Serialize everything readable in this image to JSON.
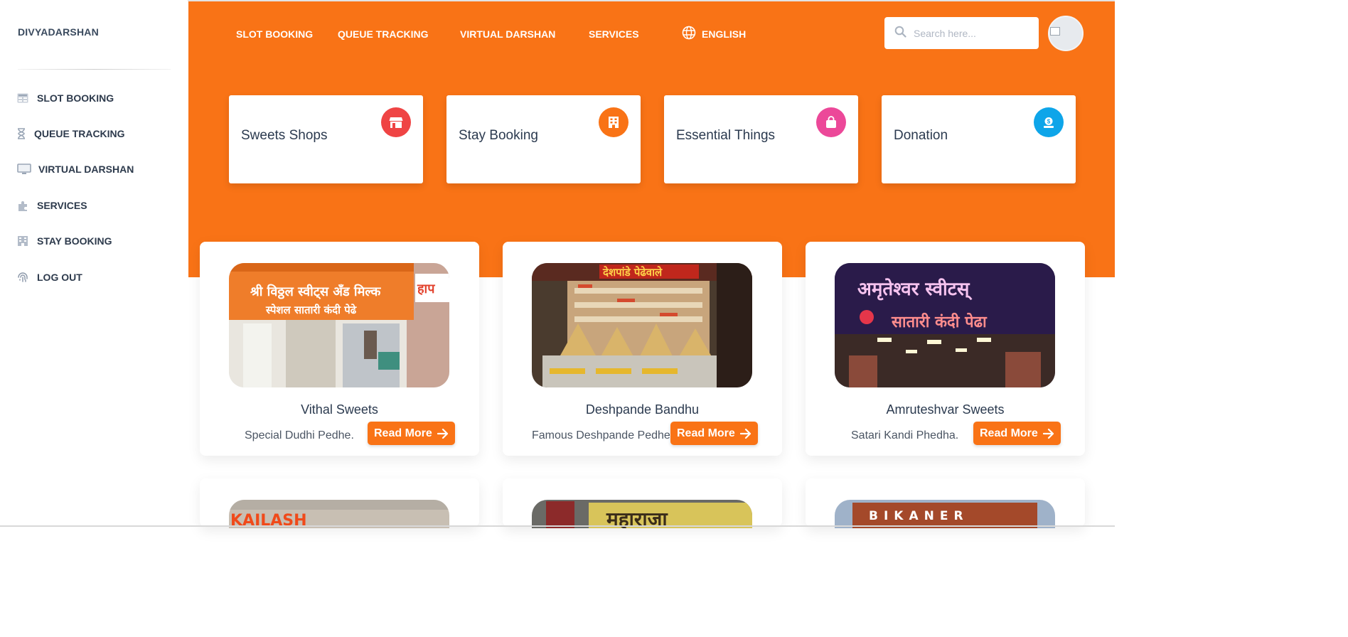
{
  "brand": "DIVYADARSHAN",
  "sidebar": {
    "items": [
      {
        "label": "SLOT BOOKING",
        "icon": "table-icon"
      },
      {
        "label": "QUEUE TRACKING",
        "icon": "hourglass-icon"
      },
      {
        "label": "VIRTUAL DARSHAN",
        "icon": "monitor-icon"
      },
      {
        "label": "SERVICES",
        "icon": "puzzle-icon"
      },
      {
        "label": "STAY BOOKING",
        "icon": "building-icon"
      },
      {
        "label": "LOG OUT",
        "icon": "fingerprint-icon"
      }
    ]
  },
  "topnav": {
    "items": [
      "SLOT BOOKING",
      "QUEUE TRACKING",
      "VIRTUAL DARSHAN",
      "SERVICES"
    ],
    "language": "ENGLISH"
  },
  "search": {
    "placeholder": "Search here..."
  },
  "categories": [
    {
      "title": "Sweets Shops",
      "color": "#ef4444",
      "icon": "store-icon"
    },
    {
      "title": "Stay Booking",
      "color": "#f97316",
      "icon": "hotel-icon"
    },
    {
      "title": "Essential Things",
      "color": "#ec4899",
      "icon": "shopping-bag-icon"
    },
    {
      "title": "Donation",
      "color": "#0ea5e9",
      "icon": "donation-icon"
    }
  ],
  "shops": [
    {
      "name": "Vithal Sweets",
      "desc": "Special Dudhi Pedhe.",
      "button": "Read More",
      "sign1": "श्री विठ्ठल स्वीट्स अँड मिल्क",
      "sign2": "स्पेशल सातारी कंदी पेढे",
      "sign3": "हाप"
    },
    {
      "name": "Deshpande Bandhu",
      "desc": "Famous Deshpande Pedhe",
      "button": "Read More",
      "sign1": "देशपांडे पेढेवाले"
    },
    {
      "name": "Amruteshvar Sweets",
      "desc": "Satari Kandi Phedha.",
      "button": "Read More",
      "sign1": "अमृतेश्वर स्वीटस्",
      "sign2": "सातारी कंदी पेढा"
    }
  ],
  "shops_row2": [
    {
      "sign": "KAILASH"
    },
    {
      "sign": "महाराजा"
    },
    {
      "sign": "BIKANER"
    }
  ]
}
